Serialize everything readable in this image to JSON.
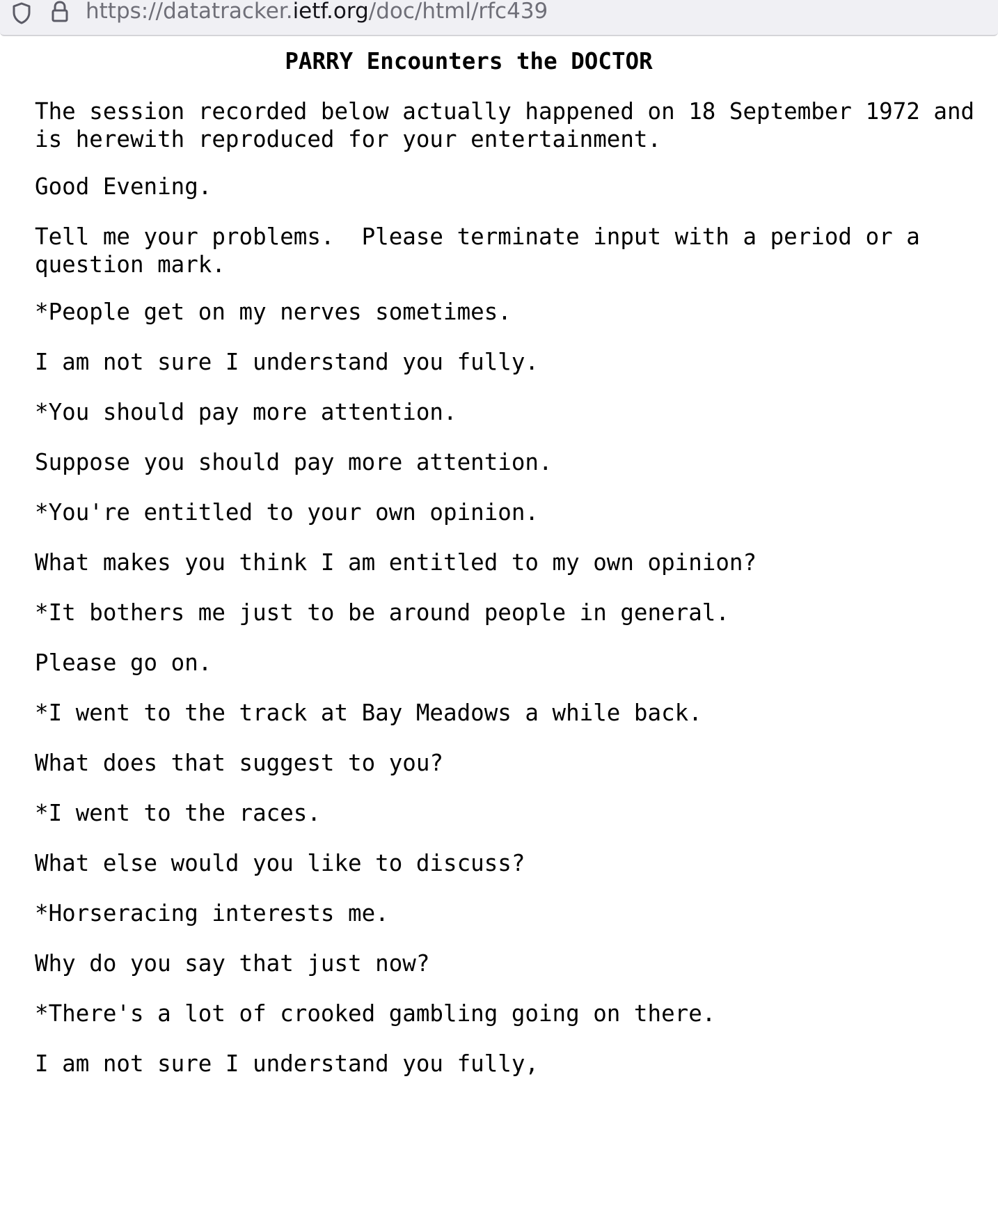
{
  "browser": {
    "url_prefix": "https://datatracker.",
    "url_host": "ietf.org",
    "url_path": "/doc/html/rfc439",
    "shield_icon": "shield-icon",
    "lock_icon": "lock-icon"
  },
  "document": {
    "title": "PARRY Encounters the DOCTOR",
    "paragraphs": [
      "The session recorded below actually happened on 18 September 1972 and\nis herewith reproduced for your entertainment.",
      "Good Evening.",
      "Tell me your problems.  Please terminate input with a period or a\nquestion mark.",
      "*People get on my nerves sometimes.",
      "I am not sure I understand you fully.",
      "*You should pay more attention.",
      "Suppose you should pay more attention.",
      "*You're entitled to your own opinion.",
      "What makes you think I am entitled to my own opinion?",
      "*It bothers me just to be around people in general.",
      "Please go on.",
      "*I went to the track at Bay Meadows a while back.",
      "What does that suggest to you?",
      "*I went to the races.",
      "What else would you like to discuss?",
      "*Horseracing interests me.",
      "Why do you say that just now?",
      "*There's a lot of crooked gambling going on there.",
      "I am not sure I understand you fully,"
    ]
  }
}
